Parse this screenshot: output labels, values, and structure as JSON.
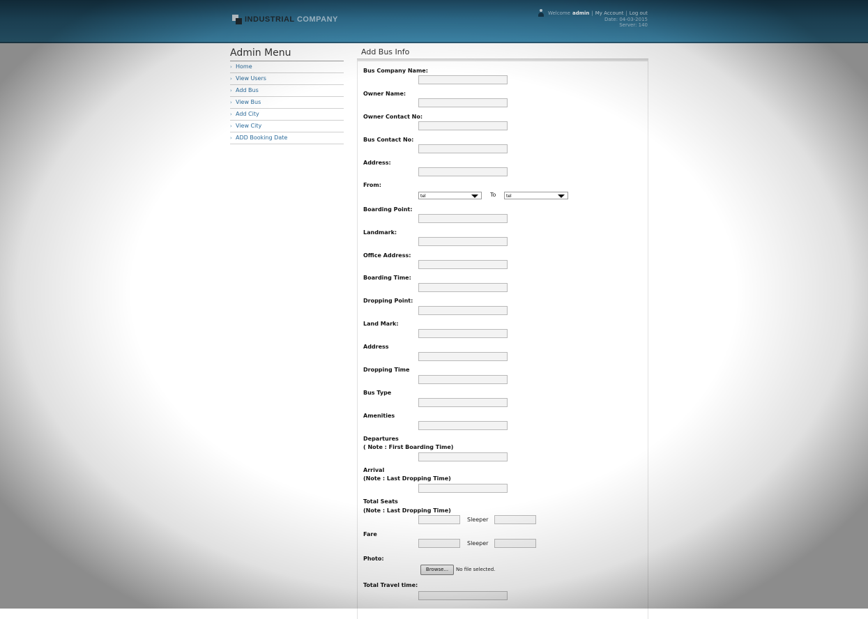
{
  "header": {
    "logo_part1": "INDUSTRIAL",
    "logo_part2": "COMPANY",
    "welcome_text": "Welcome",
    "username": "admin",
    "my_account": "My Account",
    "logout": "Log out",
    "date": "Date: 04-03-2015",
    "server": "Server: 140"
  },
  "sidebar": {
    "title": "Admin Menu",
    "items": [
      {
        "label": "Home"
      },
      {
        "label": "View Users"
      },
      {
        "label": "Add Bus"
      },
      {
        "label": "View Bus"
      },
      {
        "label": "Add City"
      },
      {
        "label": "View City"
      },
      {
        "label": "ADD Booking Date"
      }
    ]
  },
  "form": {
    "title": "Add Bus Info",
    "labels": {
      "bus_company_name": "Bus Company Name:",
      "owner_name": "Owner Name:",
      "owner_contact": "Owner Contact No:",
      "bus_contact": "Bus Contact No:",
      "address": "Address:",
      "from": "From:",
      "boarding_point": "Boarding Point:",
      "landmark": "Landmark:",
      "office_address": "Office Address:",
      "boarding_time": "Boarding Time:",
      "dropping_point": "Dropping Point:",
      "land_mark": "Land Mark:",
      "address2": "Address",
      "dropping_time": "Dropping Time",
      "bus_type": "Bus Type",
      "amenities": "Amenities",
      "departures": "Departures",
      "departures_note": "( Note : First Boarding Time)",
      "arrival": "Arrival",
      "arrival_note": "(Note : Last Dropping Time)",
      "total_seats": "Total Seats",
      "total_seats_note": "(Note : Last Dropping Time)",
      "fare": "Fare",
      "photo": "Photo:",
      "total_travel_time": "Total Travel time:"
    },
    "from_select": "tel",
    "to_label": "To",
    "to_select": "tel",
    "sleeper_label": "Sleeper",
    "browse_label": "Browse...",
    "no_file": "No file selected."
  }
}
